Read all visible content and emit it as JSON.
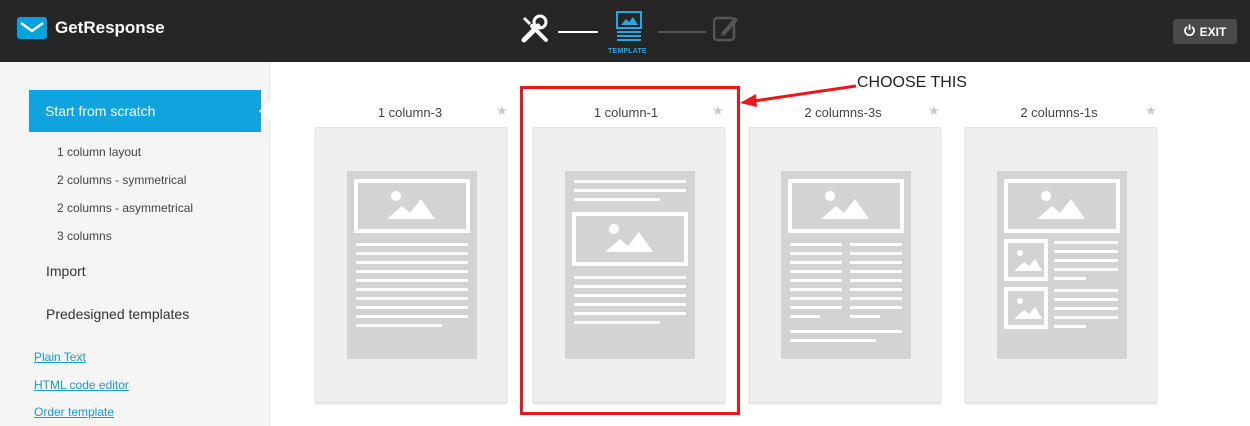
{
  "header": {
    "brand": "GetResponse",
    "step_label": "TEMPLATE",
    "exit_label": "EXIT"
  },
  "sidebar": {
    "active_item": "Start from scratch",
    "sub_items": [
      "1 column layout",
      "2 columns - symmetrical",
      "2 columns - asymmetrical",
      "3 columns"
    ],
    "items": [
      "Import",
      "Predesigned templates"
    ],
    "links": [
      "Plain Text",
      "HTML code editor",
      "Order template"
    ]
  },
  "templates": [
    {
      "title": "1 column-3"
    },
    {
      "title": "1 column-1"
    },
    {
      "title": "2 columns-3s"
    },
    {
      "title": "2 columns-1s"
    }
  ],
  "annotation": {
    "label": "CHOOSE THIS",
    "color": "#e8181f"
  },
  "colors": {
    "accent": "#0fa3e0",
    "topbar": "#262626",
    "highlight": "#e8181f"
  }
}
